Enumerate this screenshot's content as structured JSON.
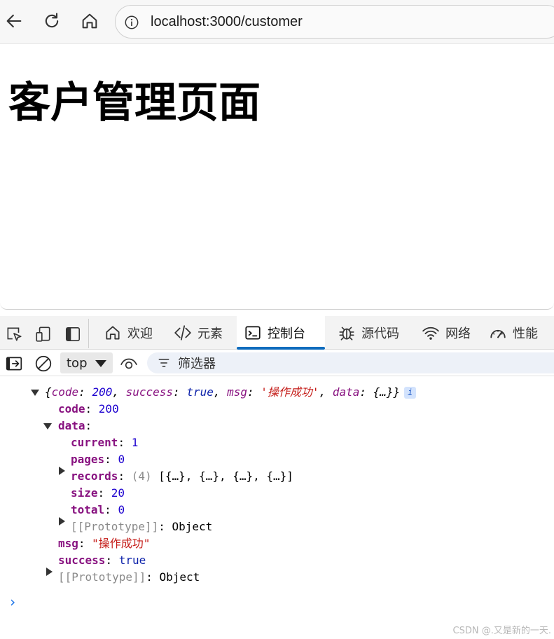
{
  "browser": {
    "back_icon": "arrow-left-icon",
    "reload_icon": "refresh-icon",
    "home_icon": "home-icon",
    "site_info_icon": "info-circle-icon",
    "url": "localhost:3000/customer"
  },
  "page": {
    "heading": "客户管理页面"
  },
  "devtools": {
    "tabs": [
      {
        "label": "欢迎",
        "icon": "home-icon"
      },
      {
        "label": "元素",
        "icon": "code-icon"
      },
      {
        "label": "控制台",
        "icon": "console-icon",
        "active": true
      },
      {
        "label": "源代码",
        "icon": "bug-icon"
      },
      {
        "label": "网络",
        "icon": "wifi-icon"
      },
      {
        "label": "性能",
        "icon": "gauge-icon"
      }
    ],
    "context": "top",
    "filter_label": "筛选器",
    "accent_color": "#0f6cbd"
  },
  "console": {
    "summary": {
      "open": "{",
      "k_code": "code",
      "v_code": "200",
      "k_success": "success",
      "v_success": "true",
      "k_msg": "msg",
      "v_msg": "'操作成功'",
      "k_data": "data",
      "v_data": "{…}",
      "close": "}",
      "badge": "i"
    },
    "code": {
      "key": "code",
      "value": "200"
    },
    "data": {
      "key": "data"
    },
    "current": {
      "key": "current",
      "value": "1"
    },
    "pages": {
      "key": "pages",
      "value": "0"
    },
    "records": {
      "key": "records",
      "count": "(4)",
      "value": "[{…}, {…}, {…}, {…}]"
    },
    "size": {
      "key": "size",
      "value": "20"
    },
    "total": {
      "key": "total",
      "value": "0"
    },
    "data_proto": {
      "key": "[[Prototype]]",
      "value": "Object"
    },
    "msg": {
      "key": "msg",
      "value": "\"操作成功\""
    },
    "success": {
      "key": "success",
      "value": "true"
    },
    "root_proto": {
      "key": "[[Prototype]]",
      "value": "Object"
    },
    "prompt": "›"
  },
  "watermark": "CSDN @.又是新的一天."
}
